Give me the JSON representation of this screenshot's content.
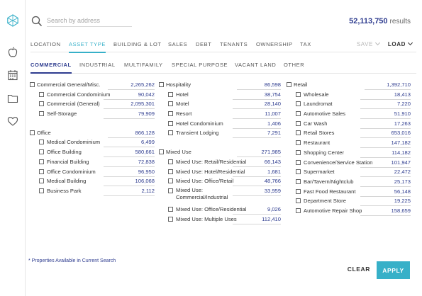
{
  "sidebar": {
    "icons": [
      "logo-icon",
      "apple-icon",
      "calendar-icon",
      "folder-icon",
      "heart-icon"
    ]
  },
  "search": {
    "placeholder": "Search by address",
    "value": ""
  },
  "results": {
    "count": "52,113,750",
    "label": "results"
  },
  "tabs": [
    "LOCATION",
    "ASSET TYPE",
    "BUILDING & LOT",
    "SALES",
    "DEBT",
    "TENANTS",
    "OWNERSHIP",
    "TAX"
  ],
  "active_tab": "ASSET TYPE",
  "save_label": "SAVE",
  "load_label": "LOAD",
  "subtabs": [
    "COMMERCIAL",
    "INDUSTRIAL",
    "MULTIFAMILY",
    "SPECIAL PURPOSE",
    "VACANT LAND",
    "OTHER"
  ],
  "active_subtab": "COMMERCIAL",
  "columns": [
    {
      "groups": [
        {
          "label": "Commercial General/Misc.",
          "count": "2,265,262",
          "items": [
            {
              "label": "Commercial Condominium",
              "count": "90,042"
            },
            {
              "label": "Commercial (General)",
              "count": "2,095,301"
            },
            {
              "label": "Self-Storage",
              "count": "79,909"
            }
          ]
        },
        {
          "label": "Office",
          "count": "866,128",
          "items": [
            {
              "label": "Medical Condominium",
              "count": "6,499"
            },
            {
              "label": "Office Building",
              "count": "580,661"
            },
            {
              "label": "Financial Building",
              "count": "72,838"
            },
            {
              "label": "Office Condominium",
              "count": "96,950"
            },
            {
              "label": "Medical Building",
              "count": "106,068"
            },
            {
              "label": "Business Park",
              "count": "2,112"
            }
          ]
        }
      ]
    },
    {
      "groups": [
        {
          "label": "Hospitality",
          "count": "86,598",
          "items": [
            {
              "label": "Hotel",
              "count": "38,754"
            },
            {
              "label": "Motel",
              "count": "28,140"
            },
            {
              "label": "Resort",
              "count": "11,007"
            },
            {
              "label": "Hotel Condominium",
              "count": "1,406"
            },
            {
              "label": "Transient Lodging",
              "count": "7,291"
            }
          ]
        },
        {
          "label": "Mixed Use",
          "count": "271,985",
          "items": [
            {
              "label": "Mixed Use: Retail/Residential",
              "count": "66,143"
            },
            {
              "label": "Mixed Use: Hotel/Residential",
              "count": "1,681"
            },
            {
              "label": "Mixed Use: Office/Retail",
              "count": "48,766"
            },
            {
              "label": "Mixed Use: Commercial/Industrial",
              "count": "33,959"
            },
            {
              "label": "Mixed Use: Office/Residential",
              "count": "9,026"
            },
            {
              "label": "Mixed Use: Multiple Uses",
              "count": "112,410"
            }
          ]
        }
      ]
    },
    {
      "groups": [
        {
          "label": "Retail",
          "count": "1,392,710",
          "items": [
            {
              "label": "Wholesale",
              "count": "18,413"
            },
            {
              "label": "Laundromat",
              "count": "7,220"
            },
            {
              "label": "Automotive Sales",
              "count": "51,910"
            },
            {
              "label": "Car Wash",
              "count": "17,263"
            },
            {
              "label": "Retail Stores",
              "count": "653,016"
            },
            {
              "label": "Restaurant",
              "count": "147,182"
            },
            {
              "label": "Shopping Center",
              "count": "114,182"
            },
            {
              "label": "Convenience/Service Station",
              "count": "101,947"
            },
            {
              "label": "Supermarket",
              "count": "22,472"
            },
            {
              "label": "Bar/Tavern/Nightclub",
              "count": "25,173"
            },
            {
              "label": "Fast Food Restaurant",
              "count": "56,148"
            },
            {
              "label": "Department Store",
              "count": "19,225"
            },
            {
              "label": "Automotive Repair Shop",
              "count": "158,659"
            }
          ]
        }
      ]
    }
  ],
  "footnote": "* Properties Available in Current Search",
  "clear_label": "CLEAR",
  "apply_label": "APPLY",
  "colors": {
    "accent": "#37b0c8",
    "navy": "#2e3c8f"
  }
}
